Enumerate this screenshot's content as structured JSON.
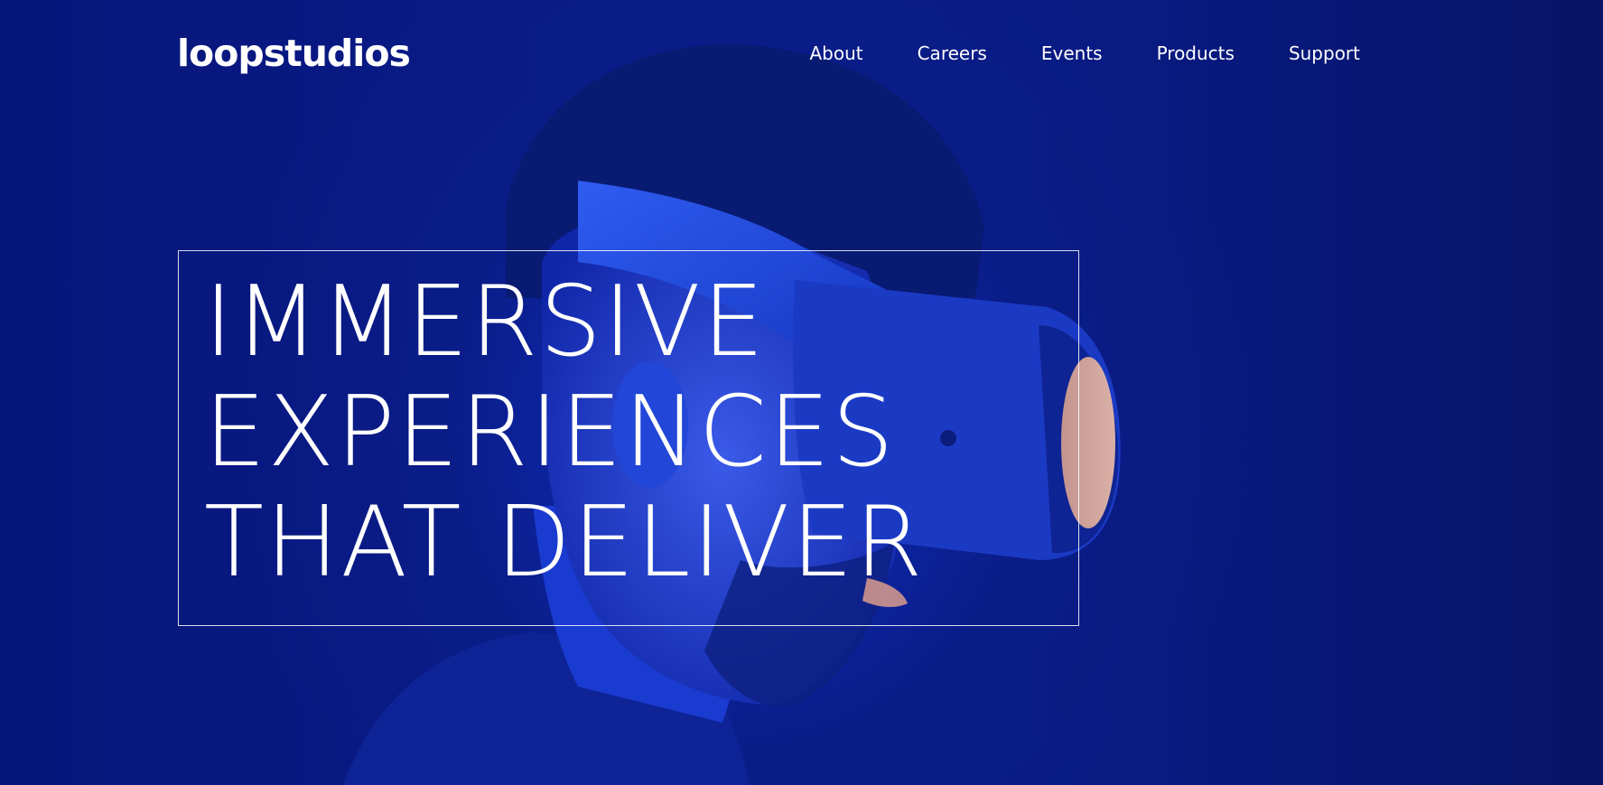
{
  "brand": {
    "logo_text": "loopstudios"
  },
  "nav": {
    "items": [
      {
        "label": "About"
      },
      {
        "label": "Careers"
      },
      {
        "label": "Events"
      },
      {
        "label": "Products"
      },
      {
        "label": "Support"
      }
    ]
  },
  "hero": {
    "headline_lines": [
      "IMMERSIVE",
      "EXPERIENCES",
      "THAT DELIVER"
    ],
    "background_description": "vr-headset-person-photo"
  },
  "colors": {
    "background": "#06156b",
    "accent_blue": "#1232b8",
    "text": "#ffffff"
  }
}
